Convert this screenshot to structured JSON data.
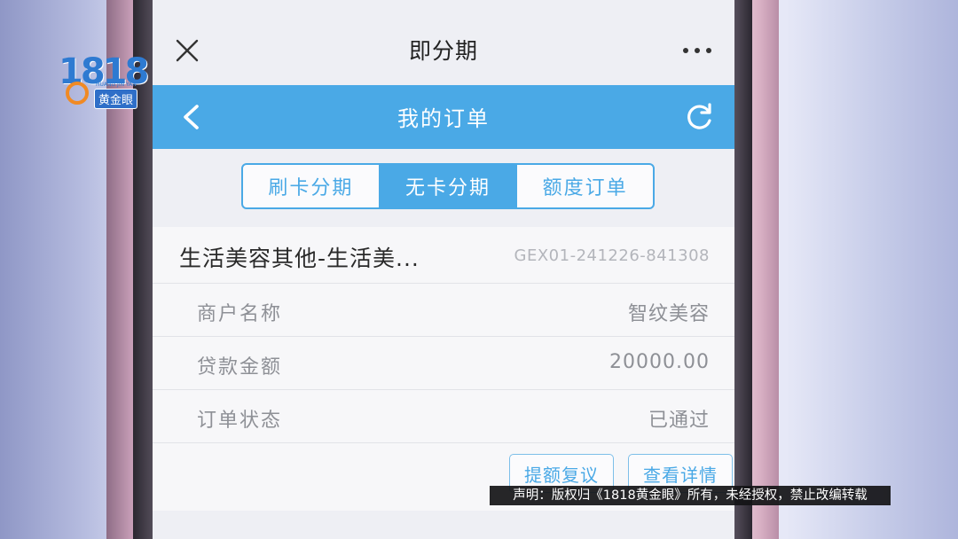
{
  "app": {
    "title": "即分期"
  },
  "nav": {
    "title": "我的订单"
  },
  "tabs": [
    {
      "label": "刷卡分期",
      "active": false
    },
    {
      "label": "无卡分期",
      "active": true
    },
    {
      "label": "额度订单",
      "active": false
    }
  ],
  "order": {
    "name": "生活美容其他-生活美...",
    "order_no": "GEX01-241226-841308",
    "rows": [
      {
        "label": "商户名称",
        "value": "智纹美容"
      },
      {
        "label": "贷款金额",
        "value": "20000.00"
      },
      {
        "label": "订单状态",
        "value": "已通过"
      }
    ],
    "actions": {
      "review_label": "提额复议",
      "detail_label": "查看详情"
    }
  },
  "watermark": {
    "logo_digits": "1818",
    "logo_pinyin": "HUANG JIN YAN",
    "logo_name": "黄金眼",
    "disclaimer": "声明：版权归《1818黄金眼》所有，未经授权，禁止改编转载"
  },
  "colors": {
    "accent": "#4aa9e6",
    "nav_bg": "#4aa9e6",
    "text_muted": "#8e9096"
  },
  "icons": {
    "close": "close-icon",
    "more": "more-icon",
    "back": "back-chevron-icon",
    "refresh": "refresh-icon"
  }
}
